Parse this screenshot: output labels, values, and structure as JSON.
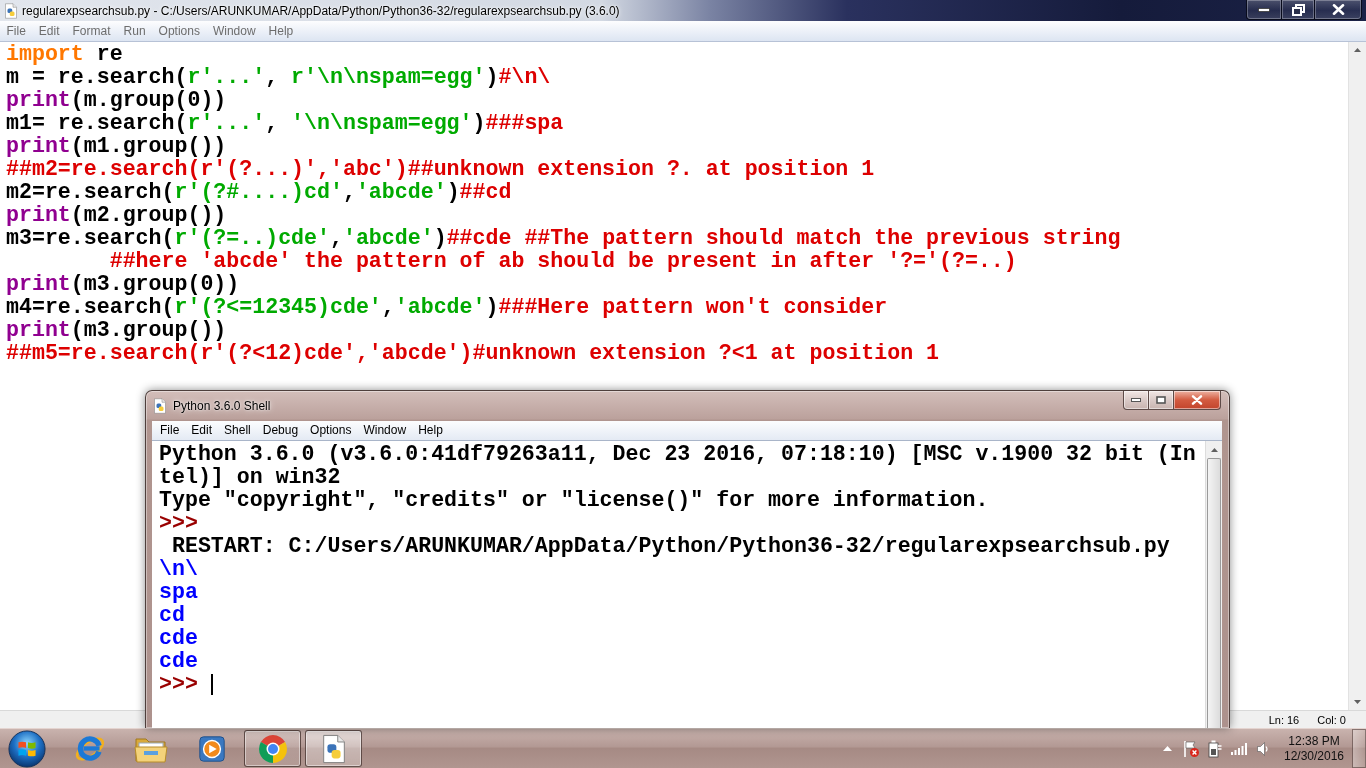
{
  "editor_window": {
    "title": "regularexpsearchsub.py - C:/Users/ARUNKUMAR/AppData/Python/Python36-32/regularexpsearchsub.py (3.6.0)",
    "active": false,
    "menu": [
      "File",
      "Edit",
      "Format",
      "Run",
      "Options",
      "Window",
      "Help"
    ],
    "code_lines": [
      {
        "tokens": [
          {
            "kind": "keyword",
            "text": "import"
          },
          {
            "kind": "plain",
            "text": " re"
          }
        ]
      },
      {
        "tokens": [
          {
            "kind": "plain",
            "text": "m = re.search("
          },
          {
            "kind": "string",
            "text": "r'...'"
          },
          {
            "kind": "plain",
            "text": ", "
          },
          {
            "kind": "string",
            "text": "r'\\n\\nspam=egg'"
          },
          {
            "kind": "plain",
            "text": ")"
          },
          {
            "kind": "comment",
            "text": "#\\n\\"
          }
        ]
      },
      {
        "tokens": [
          {
            "kind": "builtin",
            "text": "print"
          },
          {
            "kind": "plain",
            "text": "(m.group(0))"
          }
        ]
      },
      {
        "tokens": [
          {
            "kind": "plain",
            "text": "m1= re.search("
          },
          {
            "kind": "string",
            "text": "r'...'"
          },
          {
            "kind": "plain",
            "text": ", "
          },
          {
            "kind": "string",
            "text": "'\\n\\nspam=egg'"
          },
          {
            "kind": "plain",
            "text": ")"
          },
          {
            "kind": "comment",
            "text": "###spa"
          }
        ]
      },
      {
        "tokens": [
          {
            "kind": "builtin",
            "text": "print"
          },
          {
            "kind": "plain",
            "text": "(m1.group())"
          }
        ]
      },
      {
        "tokens": [
          {
            "kind": "comment",
            "text": "##m2=re.search(r'(?...)','abc')##unknown extension ?. at position 1"
          }
        ]
      },
      {
        "tokens": [
          {
            "kind": "plain",
            "text": "m2=re.search("
          },
          {
            "kind": "string",
            "text": "r'(?#....)cd'"
          },
          {
            "kind": "plain",
            "text": ","
          },
          {
            "kind": "string",
            "text": "'abcde'"
          },
          {
            "kind": "plain",
            "text": ")"
          },
          {
            "kind": "comment",
            "text": "##cd"
          }
        ]
      },
      {
        "tokens": [
          {
            "kind": "builtin",
            "text": "print"
          },
          {
            "kind": "plain",
            "text": "(m2.group())"
          }
        ]
      },
      {
        "tokens": [
          {
            "kind": "plain",
            "text": "m3=re.search("
          },
          {
            "kind": "string",
            "text": "r'(?=..)cde'"
          },
          {
            "kind": "plain",
            "text": ","
          },
          {
            "kind": "string",
            "text": "'abcde'"
          },
          {
            "kind": "plain",
            "text": ")"
          },
          {
            "kind": "comment",
            "text": "##cde ##The pattern should match the previous string"
          }
        ]
      },
      {
        "tokens": [
          {
            "kind": "comment",
            "text": "        ##here 'abcde' the pattern of ab should be present in after '?='(?=..)"
          }
        ]
      },
      {
        "tokens": [
          {
            "kind": "builtin",
            "text": "print"
          },
          {
            "kind": "plain",
            "text": "(m3.group(0))"
          }
        ]
      },
      {
        "tokens": [
          {
            "kind": "plain",
            "text": "m4=re.search("
          },
          {
            "kind": "string",
            "text": "r'(?<=12345)cde'"
          },
          {
            "kind": "plain",
            "text": ","
          },
          {
            "kind": "string",
            "text": "'abcde'"
          },
          {
            "kind": "plain",
            "text": ")"
          },
          {
            "kind": "comment",
            "text": "###Here pattern won't consider"
          }
        ]
      },
      {
        "tokens": [
          {
            "kind": "builtin",
            "text": "print"
          },
          {
            "kind": "plain",
            "text": "(m3.group())"
          }
        ]
      },
      {
        "tokens": [
          {
            "kind": "comment",
            "text": "##m5=re.search(r'(?<12)cde','abcde')#unknown extension ?<1 at position 1"
          }
        ]
      }
    ],
    "status_bar": {
      "line": "Ln: 16",
      "column": "Col: 0"
    }
  },
  "shell_window": {
    "title": "Python 3.6.0 Shell",
    "active": true,
    "menu": [
      "File",
      "Edit",
      "Shell",
      "Debug",
      "Options",
      "Window",
      "Help"
    ],
    "lines": [
      {
        "kind": "output",
        "text": "Python 3.6.0 (v3.6.0:41df79263a11, Dec 23 2016, 07:18:10) [MSC v.1900 32 bit (In"
      },
      {
        "kind": "output",
        "text": "tel)] on win32"
      },
      {
        "kind": "output",
        "text": "Type \"copyright\", \"credits\" or \"license()\" for more information."
      },
      {
        "kind": "prompt",
        "text": ">>>"
      },
      {
        "kind": "output",
        "text": " RESTART: C:/Users/ARUNKUMAR/AppData/Python/Python36-32/regularexpsearchsub.py"
      },
      {
        "kind": "stdout",
        "text": "\\n\\"
      },
      {
        "kind": "stdout",
        "text": "spa"
      },
      {
        "kind": "stdout",
        "text": "cd"
      },
      {
        "kind": "stdout",
        "text": "cde"
      },
      {
        "kind": "stdout",
        "text": "cde"
      },
      {
        "kind": "prompt",
        "text": ">>>"
      }
    ]
  },
  "taskbar": {
    "apps": [
      {
        "kind": "internet",
        "running": false,
        "selected": false
      },
      {
        "kind": "files",
        "running": false,
        "selected": false
      },
      {
        "kind": "media",
        "running": false,
        "selected": false
      },
      {
        "kind": "browser",
        "running": true,
        "selected": false
      },
      {
        "kind": "idle",
        "running": true,
        "selected": true
      }
    ],
    "clock": {
      "time": "12:38 PM",
      "date": "12/30/2016"
    }
  }
}
